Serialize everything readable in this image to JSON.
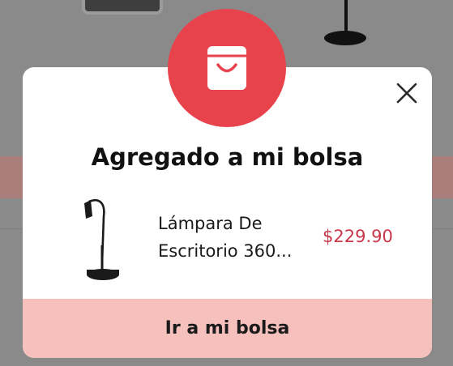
{
  "modal": {
    "title": "Agregado a mi bolsa",
    "product": {
      "name_line1": "Lámpara De",
      "name_line2": "Escritorio 360...",
      "price": "$229.90"
    },
    "cta_label": "Ir a mi bolsa"
  },
  "icons": {
    "badge": "shopping-bag-icon",
    "close": "close-icon"
  },
  "colors": {
    "badge_red": "#e8434c",
    "price_red": "#c8374a",
    "cta_pink": "#f6c1bd",
    "overlay_gray": "#8a8a8a"
  }
}
